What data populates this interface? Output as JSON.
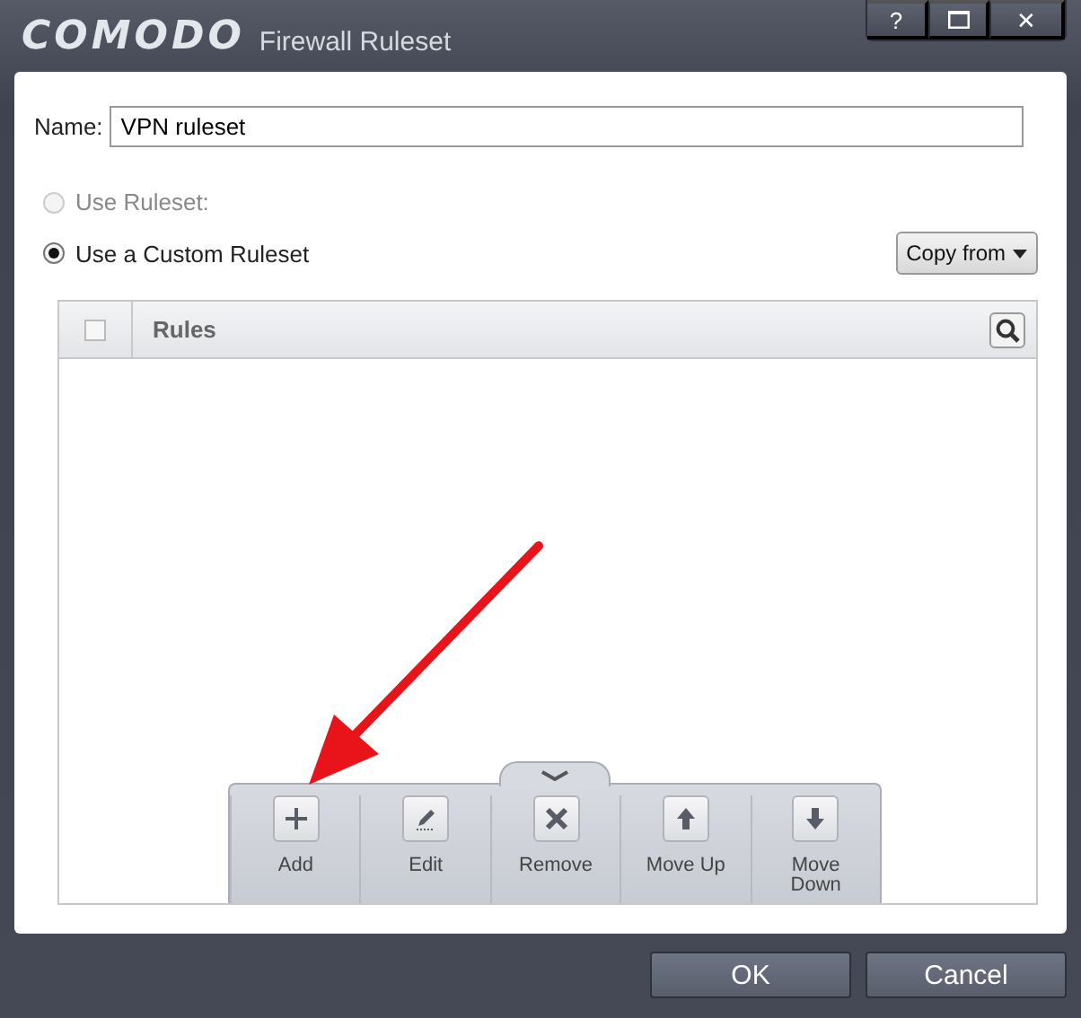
{
  "window": {
    "logo": "COMODO",
    "title": "Firewall Ruleset",
    "controls": [
      {
        "kind": "help",
        "label": "?"
      },
      {
        "kind": "maximize"
      },
      {
        "kind": "close",
        "label": "✕"
      }
    ]
  },
  "name_field": {
    "label": "Name:",
    "value": "VPN ruleset"
  },
  "options": [
    {
      "label": "Use Ruleset:",
      "selected": false,
      "disabled": true
    },
    {
      "label": "Use a Custom Ruleset",
      "selected": true,
      "disabled": false
    }
  ],
  "copy_from": {
    "label": "Copy from"
  },
  "table": {
    "select_all": {
      "checked": false
    },
    "columns": [
      "Rules"
    ]
  },
  "toolbar": [
    {
      "kind": "add",
      "label": "Add"
    },
    {
      "kind": "edit",
      "label": "Edit"
    },
    {
      "kind": "remove",
      "label": "Remove"
    },
    {
      "kind": "up",
      "label": "Move Up"
    },
    {
      "kind": "down",
      "label": "Move Down"
    }
  ],
  "buttons": [
    "OK",
    "Cancel"
  ]
}
